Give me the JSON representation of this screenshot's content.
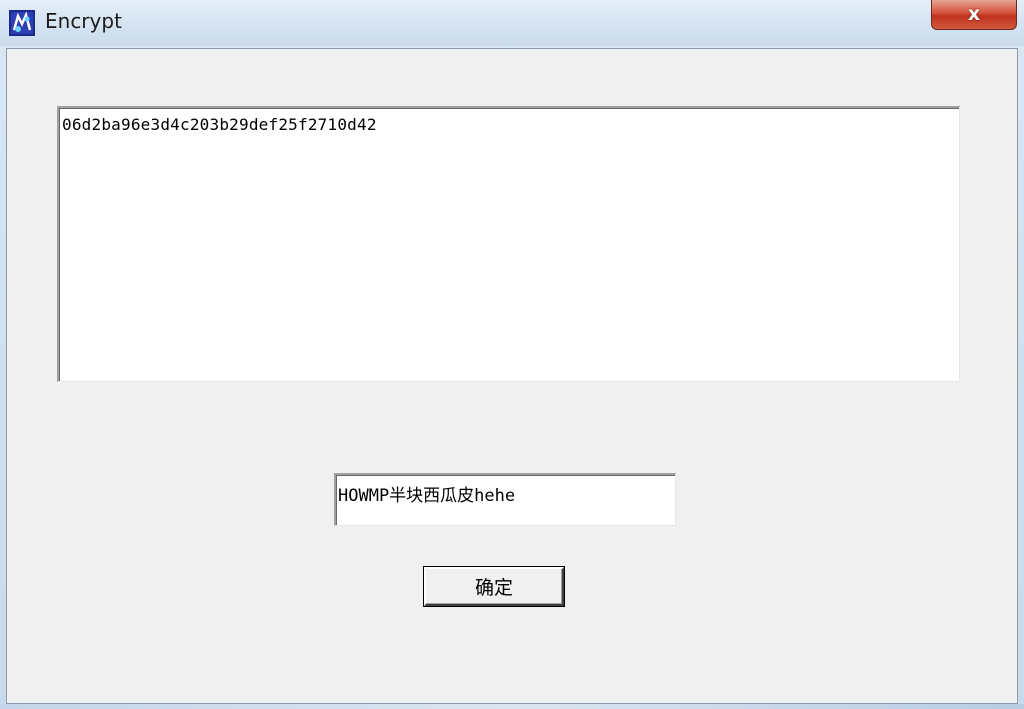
{
  "window": {
    "title": "Encrypt",
    "app_icon": "app-icon",
    "close_label": "x"
  },
  "output": {
    "value": "06d2ba96e3d4c203b29def25f2710d42"
  },
  "input": {
    "value": "HOWMP半块西瓜皮hehe"
  },
  "buttons": {
    "ok_label": "确定"
  },
  "colors": {
    "face": "#f0f0f0",
    "titlebar": "#d3e2f1",
    "close_button": "#c0321e"
  }
}
